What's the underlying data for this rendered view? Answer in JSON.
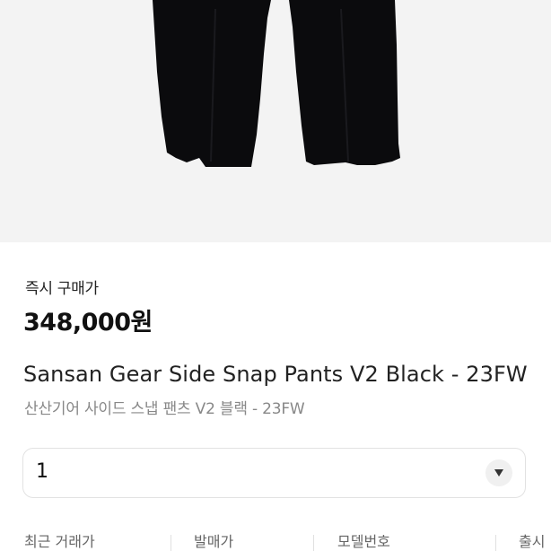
{
  "product": {
    "price_label": "즉시 구매가",
    "price": "348,000원",
    "name_en": "Sansan Gear Side Snap Pants V2 Black - 23FW",
    "name_ko": "산산기어 사이드 스냅 팬츠 V2 블랙 - 23FW"
  },
  "quantity": {
    "selected": "1",
    "arrow_icon": "chevron-down-icon"
  },
  "info": {
    "recent_price_label": "최근 거래가",
    "release_price_label": "발매가",
    "model_number_label": "모델번호",
    "release_date_label": "출시"
  },
  "colors": {
    "image_background": "#f3f3f3",
    "pants": "#0b0b0d",
    "muted_text": "#888888"
  }
}
